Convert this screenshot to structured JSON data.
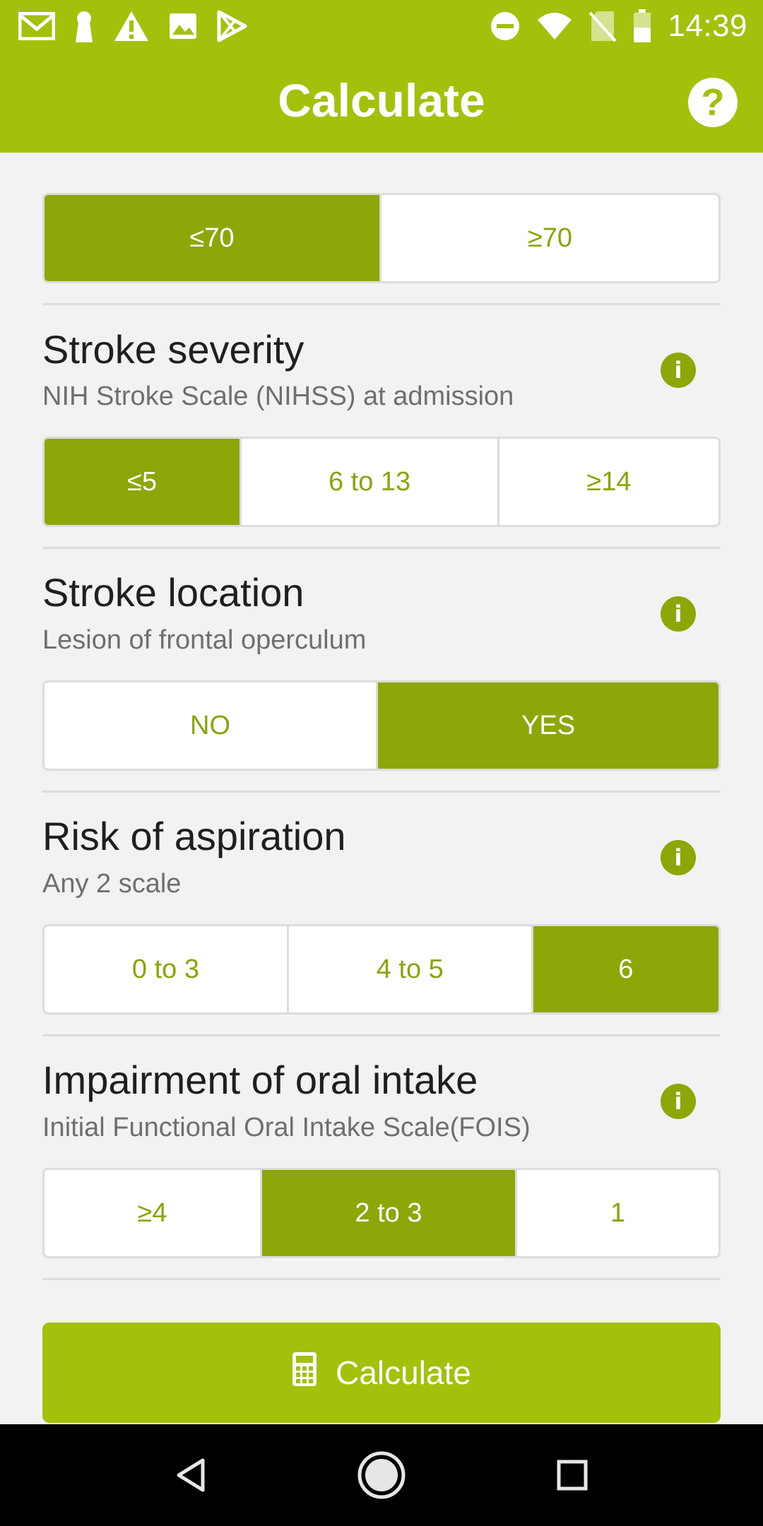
{
  "status_bar": {
    "time": "14:39",
    "left_icons": [
      "gmail-icon",
      "keyhole-icon",
      "warning-icon",
      "image-icon",
      "play-store-icon"
    ],
    "right_icons": [
      "do-not-disturb-icon",
      "wifi-icon",
      "no-sim-icon",
      "battery-icon"
    ]
  },
  "app_bar": {
    "title": "Calculate",
    "help_label": "?"
  },
  "age": {
    "options": [
      {
        "label": "≤70",
        "selected": true
      },
      {
        "label": "≥70",
        "selected": false
      }
    ]
  },
  "sections": [
    {
      "title": "Stroke severity",
      "subtitle": "NIH Stroke Scale (NIHSS) at admission",
      "options": [
        {
          "label": "≤5",
          "selected": true
        },
        {
          "label": "6 to 13",
          "selected": false
        },
        {
          "label": "≥14",
          "selected": false
        }
      ]
    },
    {
      "title": "Stroke location",
      "subtitle": "Lesion of frontal operculum",
      "options": [
        {
          "label": "NO",
          "selected": false
        },
        {
          "label": "YES",
          "selected": true
        }
      ]
    },
    {
      "title": "Risk of aspiration",
      "subtitle": "Any 2 scale",
      "options": [
        {
          "label": "0 to 3",
          "selected": false
        },
        {
          "label": "4 to 5",
          "selected": false
        },
        {
          "label": "6",
          "selected": true
        }
      ]
    },
    {
      "title": "Impairment of oral intake",
      "subtitle": "Initial Functional Oral Intake Scale(FOIS)",
      "options": [
        {
          "label": "≥4",
          "selected": false
        },
        {
          "label": "2 to 3",
          "selected": true
        },
        {
          "label": "1",
          "selected": false
        }
      ]
    }
  ],
  "info_label": "i",
  "calculate_button": {
    "label": "Calculate",
    "icon": "calculator-icon"
  },
  "nav_bar": {
    "items": [
      "back-icon",
      "home-icon",
      "recents-icon"
    ]
  },
  "colors": {
    "accent": "#a3c10b",
    "selected": "#8ca707",
    "option_text": "#8aa40a"
  }
}
